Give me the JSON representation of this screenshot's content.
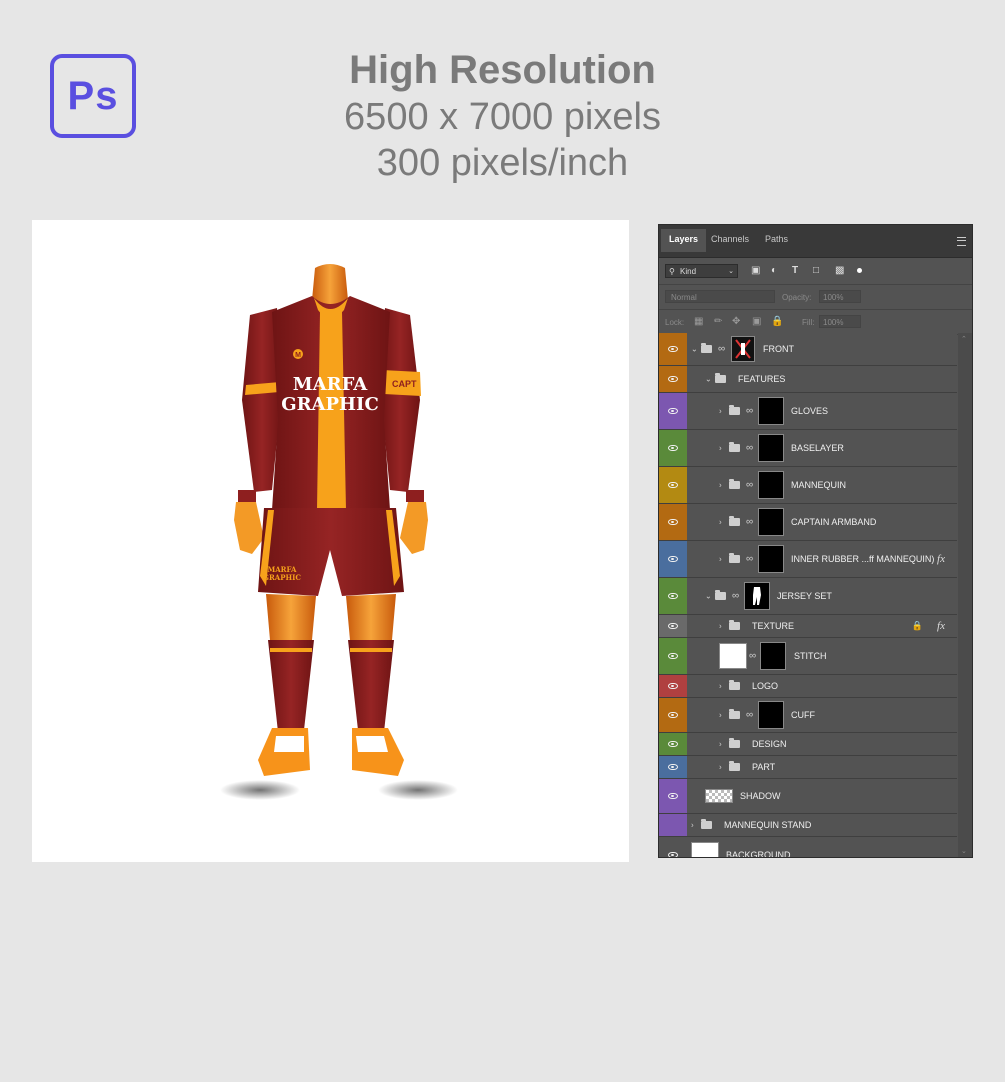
{
  "header": {
    "logo_text": "Ps",
    "title": "High Resolution",
    "resolution": "6500 x 7000 pixels",
    "dpi": "300 pixels/inch"
  },
  "preview": {
    "brand_line1": "MARFA",
    "brand_line2": "GRAPHIC",
    "small_brand_line1": "MARFA",
    "small_brand_line2": "GRAPHIC",
    "armband": "CAPT",
    "badge": "M",
    "colors": {
      "kit": "#8e1f1f",
      "stripe": "#f7a21b",
      "mannequin": "#f08a1a"
    }
  },
  "panel": {
    "tabs": [
      "Layers",
      "Channels",
      "Paths"
    ],
    "filter_kind": "Kind",
    "blend_mode": "Normal",
    "opacity_label": "Opacity:",
    "opacity_value": "100%",
    "lock_label": "Lock:",
    "fill_label": "Fill:",
    "fill_value": "100%",
    "layers": [
      {
        "name": "FRONT",
        "color": "#b36a12",
        "visible": true
      },
      {
        "name": "FEATURES",
        "color": "#b36a12",
        "visible": true
      },
      {
        "name": "GLOVES",
        "color": "#7c57b0",
        "visible": true
      },
      {
        "name": "BASELAYER",
        "color": "#5a8a3a",
        "visible": true
      },
      {
        "name": "MANNEQUIN",
        "color": "#b38a12",
        "visible": true
      },
      {
        "name": "CAPTAIN ARMBAND",
        "color": "#b36a12",
        "visible": true
      },
      {
        "name": "INNER RUBBER ...ff MANNEQUIN)",
        "color": "#4a6e9e",
        "visible": true,
        "fx": "fx"
      },
      {
        "name": "JERSEY SET",
        "color": "#5a8a3a",
        "visible": true
      },
      {
        "name": "TEXTURE",
        "color": "#6a6a6a",
        "visible": true,
        "fx": "fx",
        "locked": true
      },
      {
        "name": "STITCH",
        "color": "#5a8a3a",
        "visible": true
      },
      {
        "name": "LOGO",
        "color": "#b04040",
        "visible": true
      },
      {
        "name": "CUFF",
        "color": "#b36a12",
        "visible": true
      },
      {
        "name": "DESIGN",
        "color": "#5a8a3a",
        "visible": true
      },
      {
        "name": "PART",
        "color": "#4a6e9e",
        "visible": true
      },
      {
        "name": "SHADOW",
        "color": "#7c57b0",
        "visible": true
      },
      {
        "name": "MANNEQUIN STAND",
        "color": "#7c57b0",
        "visible": false
      },
      {
        "name": "BACKGROUND",
        "color": "#535353",
        "visible": true
      }
    ]
  }
}
